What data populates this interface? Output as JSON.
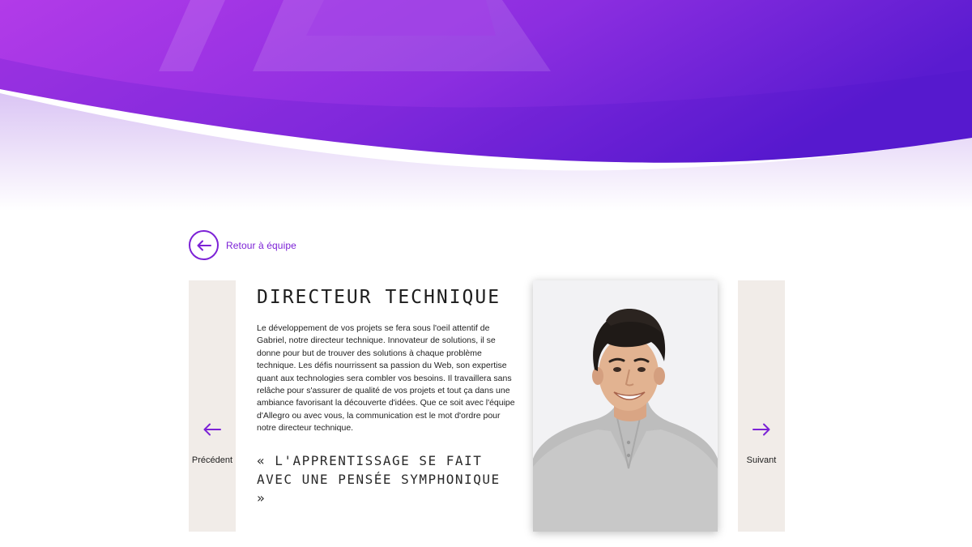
{
  "colors": {
    "accent": "#7c22d6",
    "hero_start": "#b23be8",
    "hero_end": "#5a1bd0",
    "side_bg": "#f1ece8"
  },
  "back_link": {
    "label": "Retour à équipe",
    "icon": "arrow-left-icon"
  },
  "profile": {
    "role_title": "Directeur technique",
    "bio": "Le développement de vos projets se fera sous l'oeil attentif de Gabriel, notre directeur technique. Innovateur de solutions, il se donne pour but de trouver des solutions à chaque problème technique. Les défis nourrissent sa passion du Web, son expertise quant aux technologies sera combler vos besoins. Il travaillera sans relâche pour s'assurer de qualité de vos projets et tout ça dans une ambiance favorisant la découverte d'idées. Que ce soit avec l'équipe d'Allegro ou avec vous, la communication est le mot d'ordre pour notre directeur technique.",
    "quote": "« L'apprentissage se fait avec une pensée symphonique »"
  },
  "nav": {
    "prev_label": "Précédent",
    "next_label": "Suivant",
    "prev_icon": "arrow-left-icon",
    "next_icon": "arrow-right-icon"
  }
}
